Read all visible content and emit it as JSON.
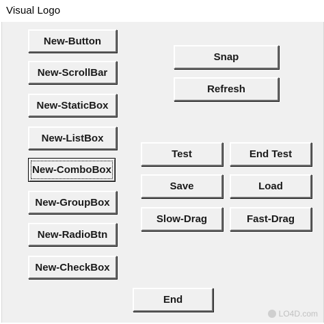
{
  "window": {
    "title": "Visual Logo"
  },
  "left_buttons": [
    {
      "label": "New-Button"
    },
    {
      "label": "New-ScrollBar"
    },
    {
      "label": "New-StaticBox"
    },
    {
      "label": "New-ListBox"
    },
    {
      "label": "New-ComboBox"
    },
    {
      "label": "New-GroupBox"
    },
    {
      "label": "New-RadioBtn"
    },
    {
      "label": "New-CheckBox"
    }
  ],
  "right_buttons": {
    "snap": "Snap",
    "refresh": "Refresh",
    "test": "Test",
    "end_test": "End Test",
    "save": "Save",
    "load": "Load",
    "slow_drag": "Slow-Drag",
    "fast_drag": "Fast-Drag",
    "end": "End"
  },
  "focused_button": "New-ComboBox",
  "watermark": {
    "text": "LO4D.com",
    "icon": "globe-icon"
  }
}
